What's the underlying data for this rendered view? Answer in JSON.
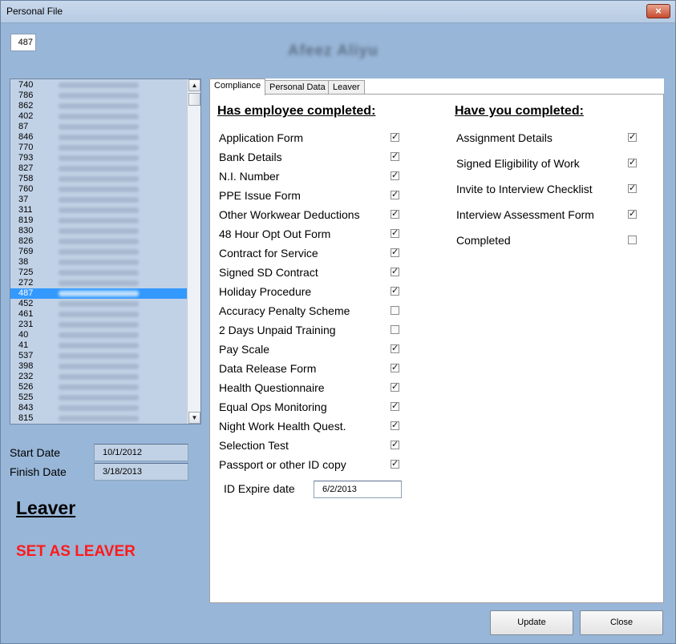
{
  "window": {
    "title": "Personal File",
    "close_glyph": "×"
  },
  "header": {
    "employee_id": "487",
    "employee_name": "Afeez   Aliyu"
  },
  "list": {
    "items": [
      {
        "code": "740"
      },
      {
        "code": "786"
      },
      {
        "code": "862"
      },
      {
        "code": "402"
      },
      {
        "code": "87"
      },
      {
        "code": "846"
      },
      {
        "code": "770"
      },
      {
        "code": "793"
      },
      {
        "code": "827"
      },
      {
        "code": "758"
      },
      {
        "code": "760"
      },
      {
        "code": "37"
      },
      {
        "code": "311"
      },
      {
        "code": "819"
      },
      {
        "code": "830"
      },
      {
        "code": "826"
      },
      {
        "code": "769"
      },
      {
        "code": "38"
      },
      {
        "code": "725"
      },
      {
        "code": "272"
      },
      {
        "code": "487"
      },
      {
        "code": "452"
      },
      {
        "code": "461"
      },
      {
        "code": "231"
      },
      {
        "code": "40"
      },
      {
        "code": "41"
      },
      {
        "code": "537"
      },
      {
        "code": "398"
      },
      {
        "code": "232"
      },
      {
        "code": "526"
      },
      {
        "code": "525"
      },
      {
        "code": "843"
      },
      {
        "code": "815"
      }
    ],
    "selected_code": "487",
    "scroll_up_glyph": "▲",
    "scroll_down_glyph": "▼"
  },
  "dates": {
    "start_label": "Start Date",
    "start_value": "10/1/2012",
    "finish_label": "Finish Date",
    "finish_value": "3/18/2013"
  },
  "leaver": {
    "heading": "Leaver",
    "action": "SET AS LEAVER",
    "action_color": "#ff1a1a"
  },
  "tabs": [
    {
      "label": "Compliance",
      "active": true
    },
    {
      "label": "Personal Data",
      "active": false
    },
    {
      "label": "Leaver",
      "active": false
    }
  ],
  "compliance": {
    "employee_title": "Has employee completed:",
    "employee_items": [
      {
        "label": "Application Form",
        "checked": true
      },
      {
        "label": "Bank Details",
        "checked": true
      },
      {
        "label": "N.I. Number",
        "checked": true
      },
      {
        "label": "PPE Issue Form",
        "checked": true
      },
      {
        "label": "Other Workwear Deductions",
        "checked": true
      },
      {
        "label": "48 Hour Opt Out Form",
        "checked": true
      },
      {
        "label": "Contract for Service",
        "checked": true
      },
      {
        "label": "Signed SD Contract",
        "checked": true
      },
      {
        "label": "Holiday Procedure",
        "checked": true
      },
      {
        "label": "Accuracy Penalty Scheme",
        "checked": false
      },
      {
        "label": "2 Days Unpaid Training",
        "checked": false
      },
      {
        "label": "Pay Scale",
        "checked": true
      },
      {
        "label": "Data Release Form",
        "checked": true
      },
      {
        "label": "Health Questionnaire",
        "checked": true
      },
      {
        "label": "Equal Ops Monitoring",
        "checked": true
      },
      {
        "label": "Night Work Health Quest.",
        "checked": true
      },
      {
        "label": "Selection Test",
        "checked": true
      },
      {
        "label": "Passport or other ID copy",
        "checked": true
      }
    ],
    "expire_label": "ID Expire date",
    "expire_value": "6/2/2013",
    "you_title": "Have you completed:",
    "you_items": [
      {
        "label": "Assignment Details",
        "checked": true
      },
      {
        "label": "Signed Eligibility of Work",
        "checked": true
      },
      {
        "label": "Invite to Interview Checklist",
        "checked": true
      },
      {
        "label": "Interview Assessment Form",
        "checked": true
      },
      {
        "label": "Completed",
        "checked": false
      }
    ]
  },
  "buttons": {
    "update": "Update",
    "close": "Close"
  },
  "check_glyph": "✓"
}
